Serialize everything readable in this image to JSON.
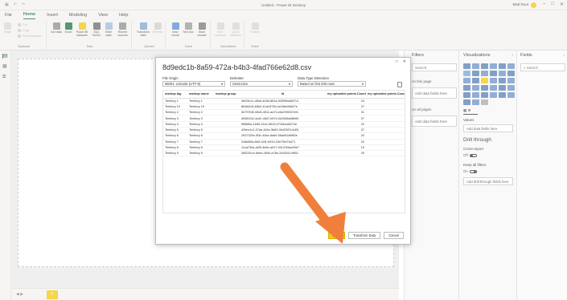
{
  "window": {
    "title": "Untitled - Power BI Desktop",
    "user": "Matt Root"
  },
  "menu": {
    "tabs": [
      "File",
      "Home",
      "Insert",
      "Modeling",
      "View",
      "Help"
    ],
    "active": "Home"
  },
  "ribbon": {
    "clipboard": {
      "label": "Clipboard",
      "paste": "Paste",
      "cut": "Cut",
      "copy": "Copy",
      "format_painter": "Format painter"
    },
    "data": {
      "label": "Data",
      "get_data": "Get data",
      "excel": "Excel",
      "power_bi_datasets": "Power BI datasets",
      "sql_server": "SQL Server",
      "enter_data": "Enter data",
      "recent_sources": "Recent sources"
    },
    "queries": {
      "label": "Queries",
      "transform_data": "Transform data",
      "refresh": "Refresh"
    },
    "insert": {
      "label": "Insert",
      "new_visual": "New visual",
      "text_box": "Text box",
      "more_visuals": "More visuals"
    },
    "calculations": {
      "label": "Calculations",
      "new_measure": "New measure",
      "quick_measure": "Quick measure"
    },
    "share": {
      "label": "Share",
      "publish": "Publish"
    }
  },
  "filters": {
    "title": "Filters",
    "search": "Search",
    "on_this_page": "on this page",
    "add_fields_1": "Add data fields here",
    "on_all_pages": "on all pages",
    "add_fields_2": "Add data fields here"
  },
  "visualizations": {
    "title": "Visualizations",
    "values_label": "Values",
    "add_fields": "Add data fields here",
    "drill_through": "Drill through",
    "cross_report": "Cross-report",
    "cross_report_state": "Off",
    "keep_all_filters": "Keep all filters",
    "keep_state": "On",
    "add_drill": "Add drill-through fields here"
  },
  "fields": {
    "title": "Fields",
    "search": "Search"
  },
  "page_tab": "+",
  "dialog": {
    "title": "8d9edc1b-8a59-472a-b4b3-4fad766e62d8.csv",
    "file_origin_label": "File Origin",
    "file_origin_value": "65001: Unicode (UTF-8)",
    "delimiter_label": "Delimiter",
    "delimiter_value": "Semicolon",
    "detection_label": "Data Type Detection",
    "detection_value": "Based on first 200 rows",
    "columns": [
      "markup tag",
      "markup name",
      "markup group",
      "Id",
      "my uploaded points.Count.00",
      "my uploaded points.Count.T"
    ],
    "rows": [
      [
        "Territory 1",
        "Territory 1",
        "",
        "4b02fc11-d5e6-4036-851a-92599ba8d714",
        "24",
        ""
      ],
      [
        "Territory 10",
        "Territory 10",
        "",
        "8fc5d2c5-83b2-41af-873d-4c15be0b607e",
        "27",
        ""
      ],
      [
        "Territory 2",
        "Territory 2",
        "",
        "5e797bf0-08d3-4511-ad74-e6e295537e91",
        "31",
        ""
      ],
      [
        "Territory 3",
        "Territory 3",
        "",
        "d93f0242-4cd2-4847-b57e-0b2585d48069",
        "27",
        ""
      ],
      [
        "Territory 4",
        "Territory 4",
        "",
        "f98585c-1b59-41b1-8515-0740bba5274e",
        "22",
        ""
      ],
      [
        "Territory 5",
        "Territory 5",
        "",
        "42bbc1c1-07ae-449c-9b63-0b42287c4d31",
        "37",
        ""
      ],
      [
        "Territory 6",
        "Territory 6",
        "",
        "2007329c-0f3c-48ce-8ad9-56a061d6f60e",
        "24",
        ""
      ],
      [
        "Territory 7",
        "Territory 7",
        "",
        "2c6b6f5a-fb0f-42f1-b913-20e79ef7d471",
        "22",
        ""
      ],
      [
        "Territory 8",
        "Territory 8",
        "",
        "11ca73cb-d4f5-4b5e-a017-94121f4aa39e7",
        "19",
        ""
      ],
      [
        "Territory 9",
        "Territory 9",
        "",
        "365251ce-6ebd-450e-a78e-2a155114f951",
        "29",
        ""
      ]
    ],
    "load": "Load",
    "transform": "Transform Data",
    "cancel": "Cancel"
  }
}
